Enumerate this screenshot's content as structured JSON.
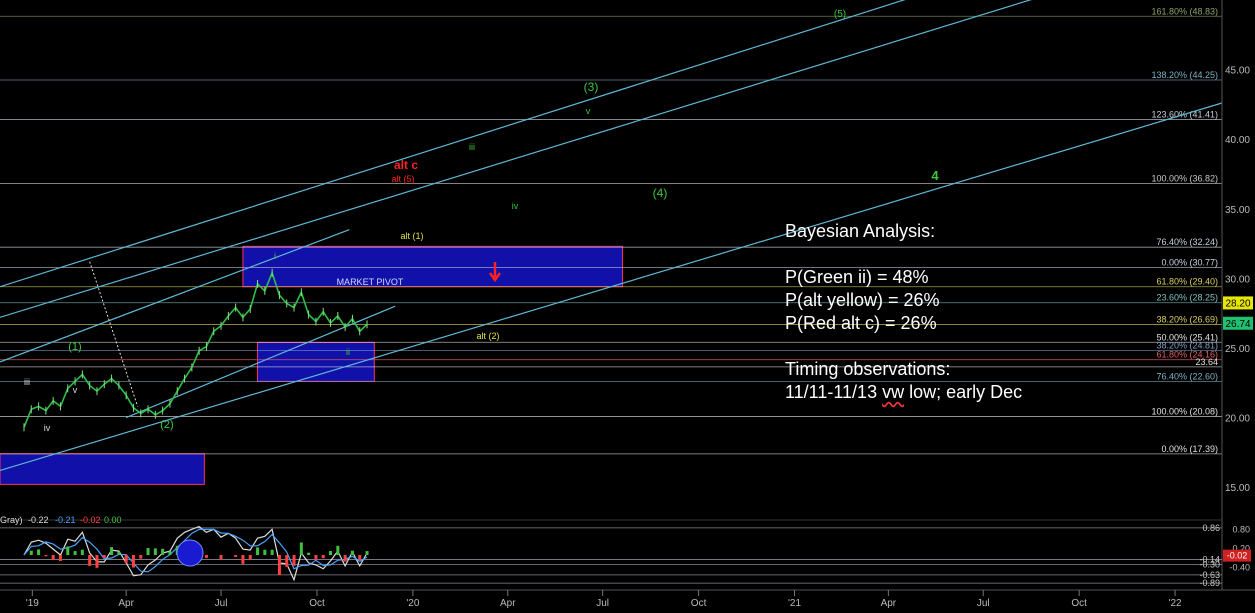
{
  "chart_data": {
    "type": "line",
    "title": "",
    "xlabel": "",
    "ylabel": "",
    "x_ticks": [
      "'19",
      "Apr",
      "Jul",
      "Oct",
      "'20",
      "Apr",
      "Jul",
      "Oct",
      "'21",
      "Apr",
      "Jul",
      "Oct",
      "'22"
    ],
    "y_ticks": [
      "45.00",
      "40.00",
      "35.00",
      "30.00",
      "25.00",
      "20.00",
      "15.00"
    ],
    "ylim": [
      13.0,
      50.0
    ],
    "grid": false,
    "fib_levels": [
      {
        "label": "161.80% (48.83)",
        "value": 48.83,
        "color": "#8fa06a"
      },
      {
        "label": "138.20% (44.25)",
        "value": 44.25,
        "color": "#7fb0c8"
      },
      {
        "label": "123.60% (41.41)",
        "value": 41.41,
        "color": "#c8d0d8"
      },
      {
        "label": "100.00% (36.82)",
        "value": 36.82,
        "color": "#c8c8c8"
      },
      {
        "label": "76.40% (32.24)",
        "value": 32.24,
        "color": "#c8d0e0"
      },
      {
        "label": "0.00% (30.77)",
        "value": 30.77,
        "color": "#c8d0e0"
      },
      {
        "label": "61.80% (29.40)",
        "value": 29.4,
        "color": "#d8d060"
      },
      {
        "label": "23.60% (28.25)",
        "value": 28.25,
        "color": "#80c0c0"
      },
      {
        "label": "38.20% (26.69)",
        "value": 26.69,
        "color": "#d8d060"
      },
      {
        "label": "50.00% (25.41)",
        "value": 25.41,
        "color": "#e0e0e0"
      },
      {
        "label": "38.20% (24.81)",
        "value": 24.81,
        "color": "#7f9fc8"
      },
      {
        "label": "61.80% (24.16)",
        "value": 24.16,
        "color": "#e06060"
      },
      {
        "label": "23.64",
        "value": 23.64,
        "color": "#e0e0e0"
      },
      {
        "label": "76.40% (22.60)",
        "value": 22.6,
        "color": "#7fb0c8"
      },
      {
        "label": "100.00% (20.08)",
        "value": 20.08,
        "color": "#e0e0e0"
      },
      {
        "label": "0.00% (17.39)",
        "value": 17.39,
        "color": "#e0e0e0"
      }
    ],
    "price_tags": [
      {
        "label": "28.20",
        "value": 28.2,
        "color": "#e6e600",
        "text_color": "#000"
      },
      {
        "label": "26.74",
        "value": 26.74,
        "color": "#20c070",
        "text_color": "#000"
      }
    ],
    "wave_labels": [
      {
        "text": "(5)",
        "color": "#3cc83c"
      },
      {
        "text": "(3)",
        "color": "#3cc83c"
      },
      {
        "text": "v",
        "color": "#3cc83c"
      },
      {
        "text": "iii",
        "color": "#3cc83c"
      },
      {
        "text": "alt c",
        "color": "#ff2020"
      },
      {
        "text": "alt (5)",
        "color": "#ff2020"
      },
      {
        "text": "(4)",
        "color": "#3cc83c"
      },
      {
        "text": "4",
        "color": "#3cc83c"
      },
      {
        "text": "iv",
        "color": "#3cc83c"
      },
      {
        "text": "alt (1)",
        "color": "#e0e040"
      },
      {
        "text": "i",
        "color": "#3cc83c"
      },
      {
        "text": "MARKET PIVOT",
        "color": "#d0d8ff"
      },
      {
        "text": "alt (2)",
        "color": "#e0e040"
      },
      {
        "text": "ii",
        "color": "#3cc83c"
      },
      {
        "text": "(1)",
        "color": "#3cc83c"
      },
      {
        "text": "v",
        "color": "#ddd"
      },
      {
        "text": "iii",
        "color": "#ddd"
      },
      {
        "text": "iv",
        "color": "#ddd"
      },
      {
        "text": "(2)",
        "color": "#3cc83c"
      }
    ],
    "price_series": [
      [
        "2018-12-24",
        19.3
      ],
      [
        "2018-12-31",
        20.6
      ],
      [
        "2019-01-07",
        20.8
      ],
      [
        "2019-01-14",
        20.5
      ],
      [
        "2019-01-21",
        21.2
      ],
      [
        "2019-01-28",
        20.8
      ],
      [
        "2019-02-04",
        22.1
      ],
      [
        "2019-02-11",
        22.6
      ],
      [
        "2019-02-18",
        23.1
      ],
      [
        "2019-02-25",
        22.3
      ],
      [
        "2019-03-04",
        21.9
      ],
      [
        "2019-03-11",
        22.4
      ],
      [
        "2019-03-18",
        22.8
      ],
      [
        "2019-03-25",
        22.3
      ],
      [
        "2019-04-01",
        21.6
      ],
      [
        "2019-04-08",
        20.7
      ],
      [
        "2019-04-15",
        20.3
      ],
      [
        "2019-04-22",
        20.6
      ],
      [
        "2019-04-29",
        20.2
      ],
      [
        "2019-05-06",
        20.5
      ],
      [
        "2019-05-13",
        21.0
      ],
      [
        "2019-05-20",
        21.9
      ],
      [
        "2019-05-27",
        22.8
      ],
      [
        "2019-06-03",
        23.6
      ],
      [
        "2019-06-10",
        24.8
      ],
      [
        "2019-06-17",
        25.1
      ],
      [
        "2019-06-24",
        26.2
      ],
      [
        "2019-07-01",
        26.6
      ],
      [
        "2019-07-08",
        27.3
      ],
      [
        "2019-07-15",
        27.9
      ],
      [
        "2019-07-22",
        27.2
      ],
      [
        "2019-07-29",
        27.8
      ],
      [
        "2019-08-05",
        29.6
      ],
      [
        "2019-08-12",
        29.1
      ],
      [
        "2019-08-19",
        30.4
      ],
      [
        "2019-08-26",
        28.8
      ],
      [
        "2019-09-02",
        28.2
      ],
      [
        "2019-09-09",
        27.9
      ],
      [
        "2019-09-16",
        29.0
      ],
      [
        "2019-09-23",
        27.4
      ],
      [
        "2019-09-30",
        26.9
      ],
      [
        "2019-10-07",
        27.6
      ],
      [
        "2019-10-14",
        26.8
      ],
      [
        "2019-10-21",
        27.3
      ],
      [
        "2019-10-28",
        26.5
      ],
      [
        "2019-11-04",
        27.1
      ],
      [
        "2019-11-11",
        26.2
      ],
      [
        "2019-11-18",
        26.7
      ]
    ],
    "channels": [
      {
        "from": [
          "2018-12-01",
          29.4
        ],
        "to": [
          "2021-10-01",
          54.0
        ],
        "color": "#5fb8d6"
      },
      {
        "from": [
          "2018-12-01",
          27.2
        ],
        "to": [
          "2021-12-01",
          52.5
        ],
        "color": "#5fb8d6"
      },
      {
        "from": [
          "2018-12-01",
          16.2
        ],
        "to": [
          "2022-02-15",
          42.6
        ],
        "color": "#5fb8d6"
      },
      {
        "from": [
          "2018-12-01",
          24.0
        ],
        "to": [
          "2019-11-01",
          33.5
        ],
        "color": "#5fb8d6"
      },
      {
        "from": [
          "2019-04-01",
          20.0
        ],
        "to": [
          "2019-12-15",
          28.0
        ],
        "color": "#5fb8d6"
      }
    ],
    "zones": [
      {
        "name": "market-pivot-zone",
        "from": "2019-07-22",
        "to": "2020-07-20",
        "low": 29.4,
        "high": 32.3
      },
      {
        "name": "support-zone",
        "from": "2019-08-05",
        "to": "2019-11-25",
        "low": 22.6,
        "high": 25.4
      },
      {
        "name": "lower-zone",
        "from": "2018-12-01",
        "to": "2019-06-15",
        "low": 15.2,
        "high": 17.4
      }
    ],
    "indicator": {
      "label": "Gray)",
      "values": [
        "-0.22",
        "-0.21",
        "-0.02",
        "0.00"
      ],
      "value_colors": [
        "#dddddd",
        "#4aa3ff",
        "#ff4040",
        "#40c040"
      ],
      "y_ticks": [
        "0.80",
        "0.20",
        "-0.40"
      ],
      "levels": [
        "0.86",
        "-0.14",
        "-0.30",
        "-0.63",
        "-0.89"
      ],
      "current_value": "-0.02"
    }
  },
  "annotation": {
    "heading": "Bayesian Analysis:",
    "probabilities": [
      "P(Green ii) = 48%",
      "P(alt yellow) = 26%",
      "P(Red alt c) = 26%"
    ],
    "timing_heading": "Timing observations:",
    "timing_text_prefix": "11/11-11/13 ",
    "timing_text_flag": "vw",
    "timing_text_suffix": " low; early Dec"
  }
}
